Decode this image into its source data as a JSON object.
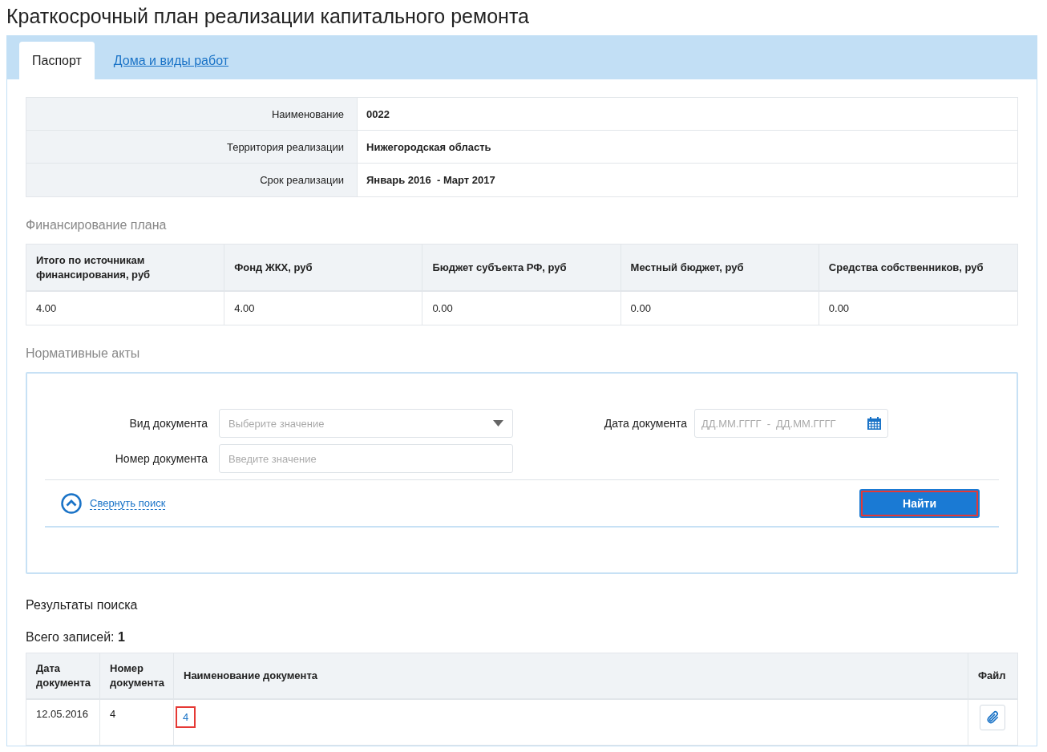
{
  "title": "Краткосрочный план реализации капитального ремонта",
  "tabs": [
    {
      "label": "Паспорт",
      "selected": true
    },
    {
      "label": "Дома и виды работ",
      "selected": false
    }
  ],
  "passport": [
    {
      "label": "Наименование",
      "value": "0022"
    },
    {
      "label": "Территория реализации",
      "value": "Нижегородская область"
    },
    {
      "label": "Срок реализации",
      "value": "Январь 2016  - Март 2017"
    }
  ],
  "financing": {
    "title": "Финансирование плана",
    "columns": [
      "Итого по источникам финансирования, руб",
      "Фонд ЖКХ, руб",
      "Бюджет субъекта РФ, руб",
      "Местный бюджет, руб",
      "Средства собственников, руб"
    ],
    "values": [
      "4.00",
      "4.00",
      "0.00",
      "0.00",
      "0.00"
    ]
  },
  "acts": {
    "title": "Нормативные акты",
    "doc_type": {
      "label": "Вид документа",
      "placeholder": "Выберите значение"
    },
    "doc_number": {
      "label": "Номер документа",
      "placeholder": "Введите значение"
    },
    "doc_date": {
      "label": "Дата документа",
      "from_placeholder": "ДД.ММ.ГГГГ",
      "separator": "-",
      "to_placeholder": "ДД.ММ.ГГГГ"
    },
    "collapse_link": "Свернуть поиск",
    "search_button": {
      "label": "Найти",
      "highlighted": true
    }
  },
  "results": {
    "title": "Результаты поиска",
    "total_label": "Всего записей:",
    "total": "1",
    "columns": [
      "Дата документа",
      "Номер документа",
      "Наименование документа",
      "Файл"
    ],
    "rows": [
      {
        "date": "12.05.2016",
        "number": "4",
        "name": "4",
        "name_highlighted": true
      }
    ]
  }
}
